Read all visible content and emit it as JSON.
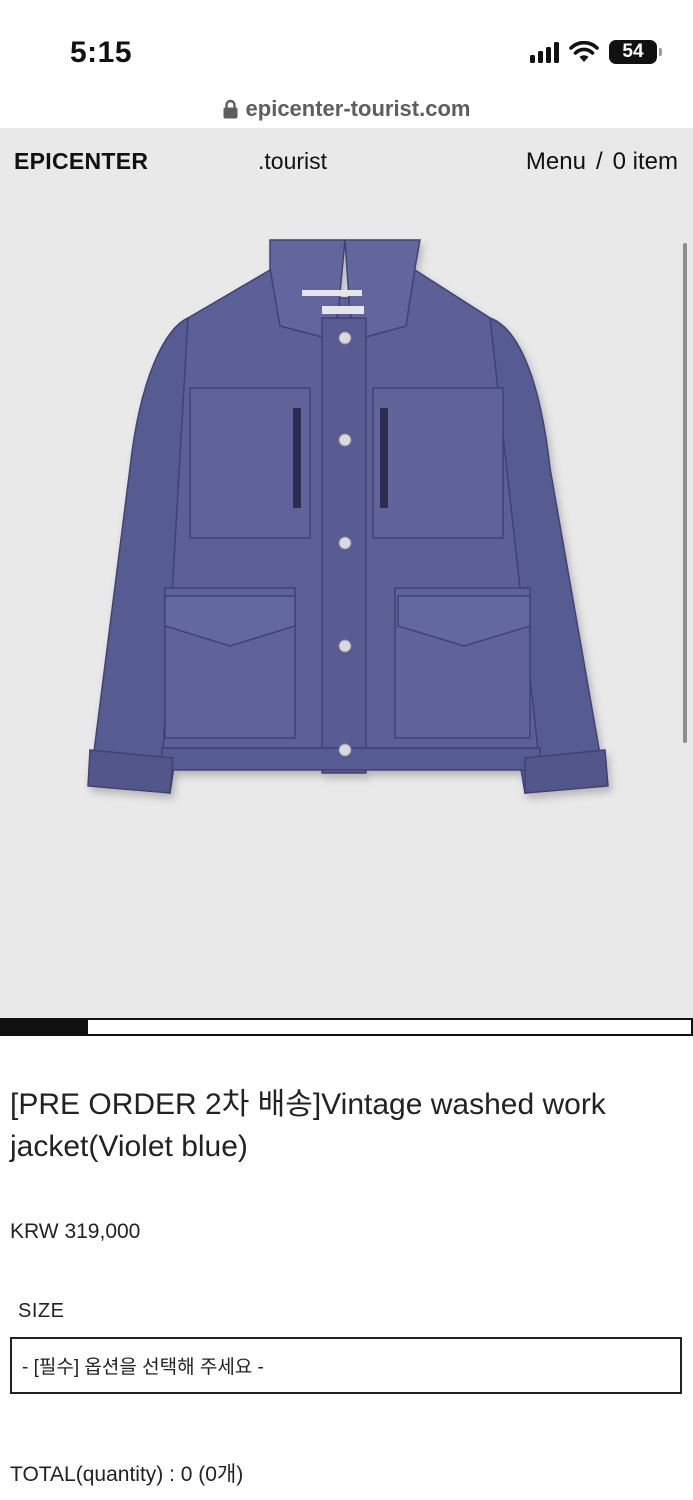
{
  "status_bar": {
    "time": "5:15",
    "battery": "54",
    "icons": [
      "cellular-signal-icon",
      "wifi-icon",
      "battery-icon"
    ]
  },
  "browser": {
    "url": "epicenter-tourist.com",
    "lock_icon": "lock-icon"
  },
  "header": {
    "brand": "EPICENTER",
    "sub_brand": ".tourist",
    "menu_label": "Menu",
    "separator": "/",
    "cart_label": "0 item"
  },
  "gallery": {
    "image_subject": "Vintage washed work jacket, violet blue",
    "slide_progress": 0.125
  },
  "product": {
    "title": "[PRE ORDER 2차 배송]Vintage washed work jacket(Violet blue)",
    "price": "KRW 319,000",
    "option_label": "SIZE",
    "option_selected": "- [필수] 옵션을 선택해 주세요 -",
    "total": "TOTAL(quantity) : 0 (0개)"
  },
  "colors": {
    "hero_background": "#e9e9e9",
    "jacket": "#5b5f95",
    "text": "#111111"
  }
}
